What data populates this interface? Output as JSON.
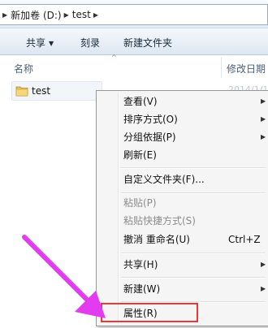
{
  "address_bar": {
    "crumbs": [
      "新加卷 (D:)",
      "test"
    ],
    "chevron_icon": "chevron-right-icon"
  },
  "toolbar": {
    "share_label": "共享",
    "burn_label": "刻录",
    "new_folder_label": "新建文件夹"
  },
  "columns": {
    "name": "名称",
    "date_modified": "修改日期"
  },
  "files": [
    {
      "name": "test",
      "date": "2014/1/1",
      "icon": "folder-icon"
    }
  ],
  "context_menu": {
    "items": [
      {
        "label": "查看(V)",
        "submenu": true
      },
      {
        "label": "排序方式(O)",
        "submenu": true
      },
      {
        "label": "分组依据(P)",
        "submenu": true
      },
      {
        "label": "刷新(E)"
      },
      {
        "label": "自定义文件夹(F)..."
      },
      {
        "label": "粘贴(P)",
        "disabled": true
      },
      {
        "label": "粘贴快捷方式(S)",
        "disabled": true
      },
      {
        "label": "撤消 重命名(U)",
        "shortcut": "Ctrl+Z"
      },
      {
        "label": "共享(H)",
        "submenu": true
      },
      {
        "label": "新建(W)",
        "submenu": true
      },
      {
        "label": "属性(R)",
        "highlighted": true
      }
    ]
  },
  "colors": {
    "annotation_arrow": "#e33cf0",
    "highlight_box": "#e8383a"
  }
}
